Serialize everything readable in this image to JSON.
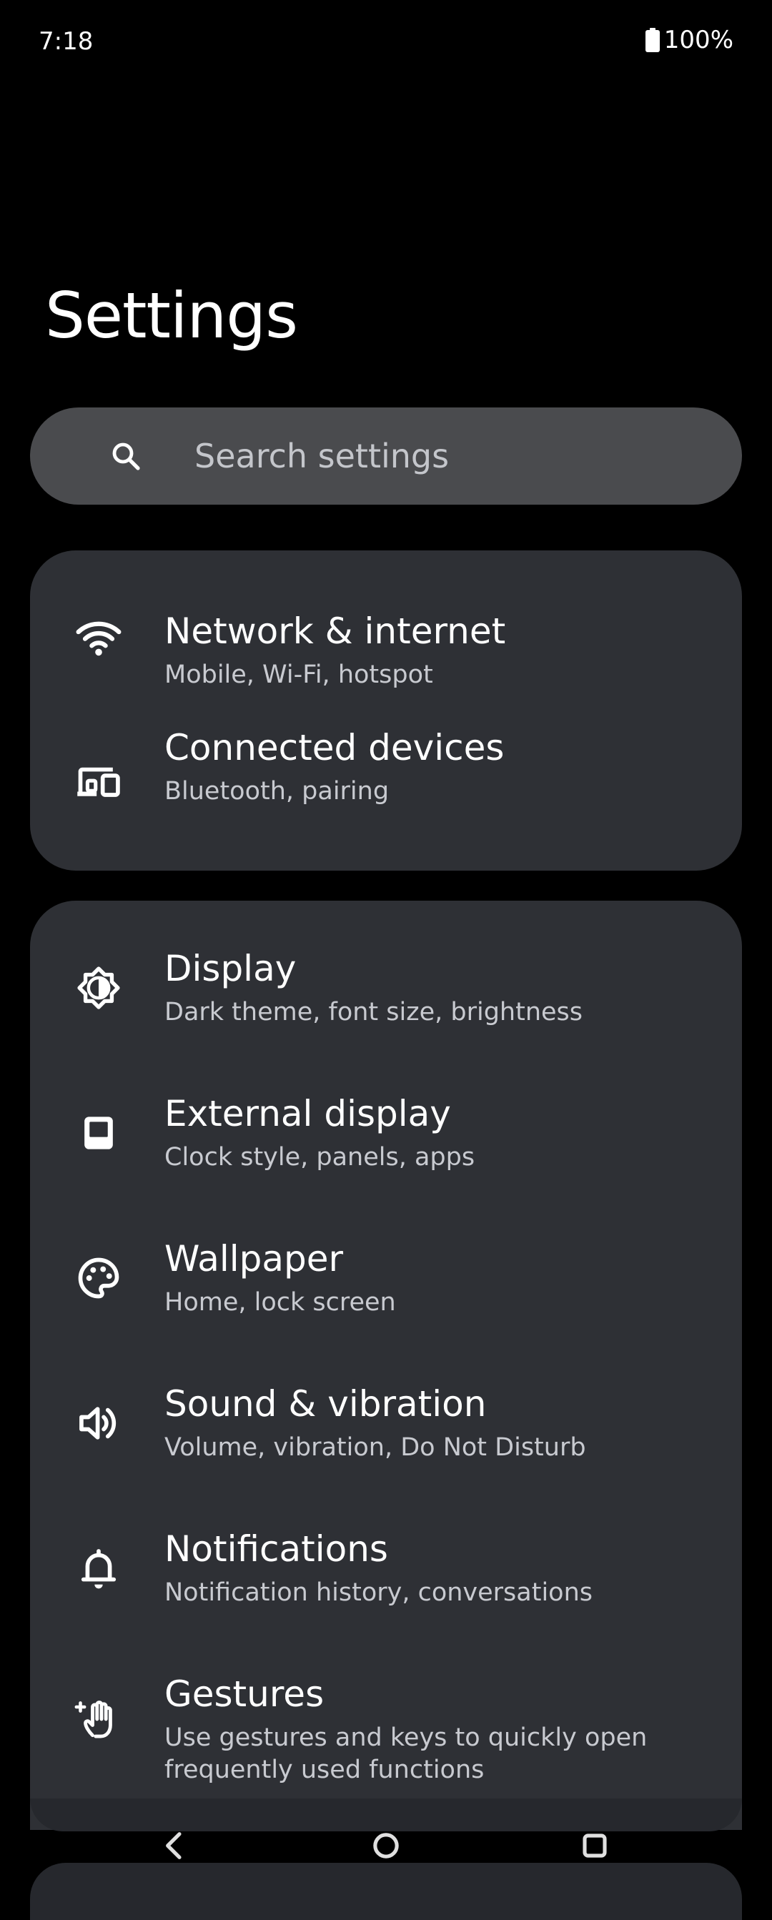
{
  "status_bar": {
    "time": "7:18",
    "battery": "100%"
  },
  "page": {
    "title": "Settings"
  },
  "search": {
    "placeholder": "Search settings"
  },
  "groups": [
    {
      "items": [
        {
          "title": "Network & internet",
          "subtitle": "Mobile, Wi-Fi, hotspot",
          "icon": "wifi-icon"
        },
        {
          "title": "Connected devices",
          "subtitle": "Bluetooth, pairing",
          "icon": "devices-icon"
        }
      ]
    },
    {
      "items": [
        {
          "title": "Display",
          "subtitle": "Dark theme, font size, brightness",
          "icon": "brightness-icon"
        },
        {
          "title": "External display",
          "subtitle": "Clock style, panels, apps",
          "icon": "external-display-icon"
        },
        {
          "title": "Wallpaper",
          "subtitle": "Home, lock screen",
          "icon": "palette-icon"
        },
        {
          "title": "Sound & vibration",
          "subtitle": "Volume, vibration, Do Not Disturb",
          "icon": "speaker-icon"
        },
        {
          "title": "Notifications",
          "subtitle": "Notification history, conversations",
          "icon": "bell-icon"
        },
        {
          "title": "Gestures",
          "subtitle": "Use gestures and keys to quickly open frequently used functions",
          "icon": "gesture-hand-icon"
        }
      ]
    }
  ],
  "colors": {
    "background": "#000000",
    "card": "#2e3035",
    "search_bg": "#4a4b4e",
    "subtitle": "#c8cad0"
  }
}
